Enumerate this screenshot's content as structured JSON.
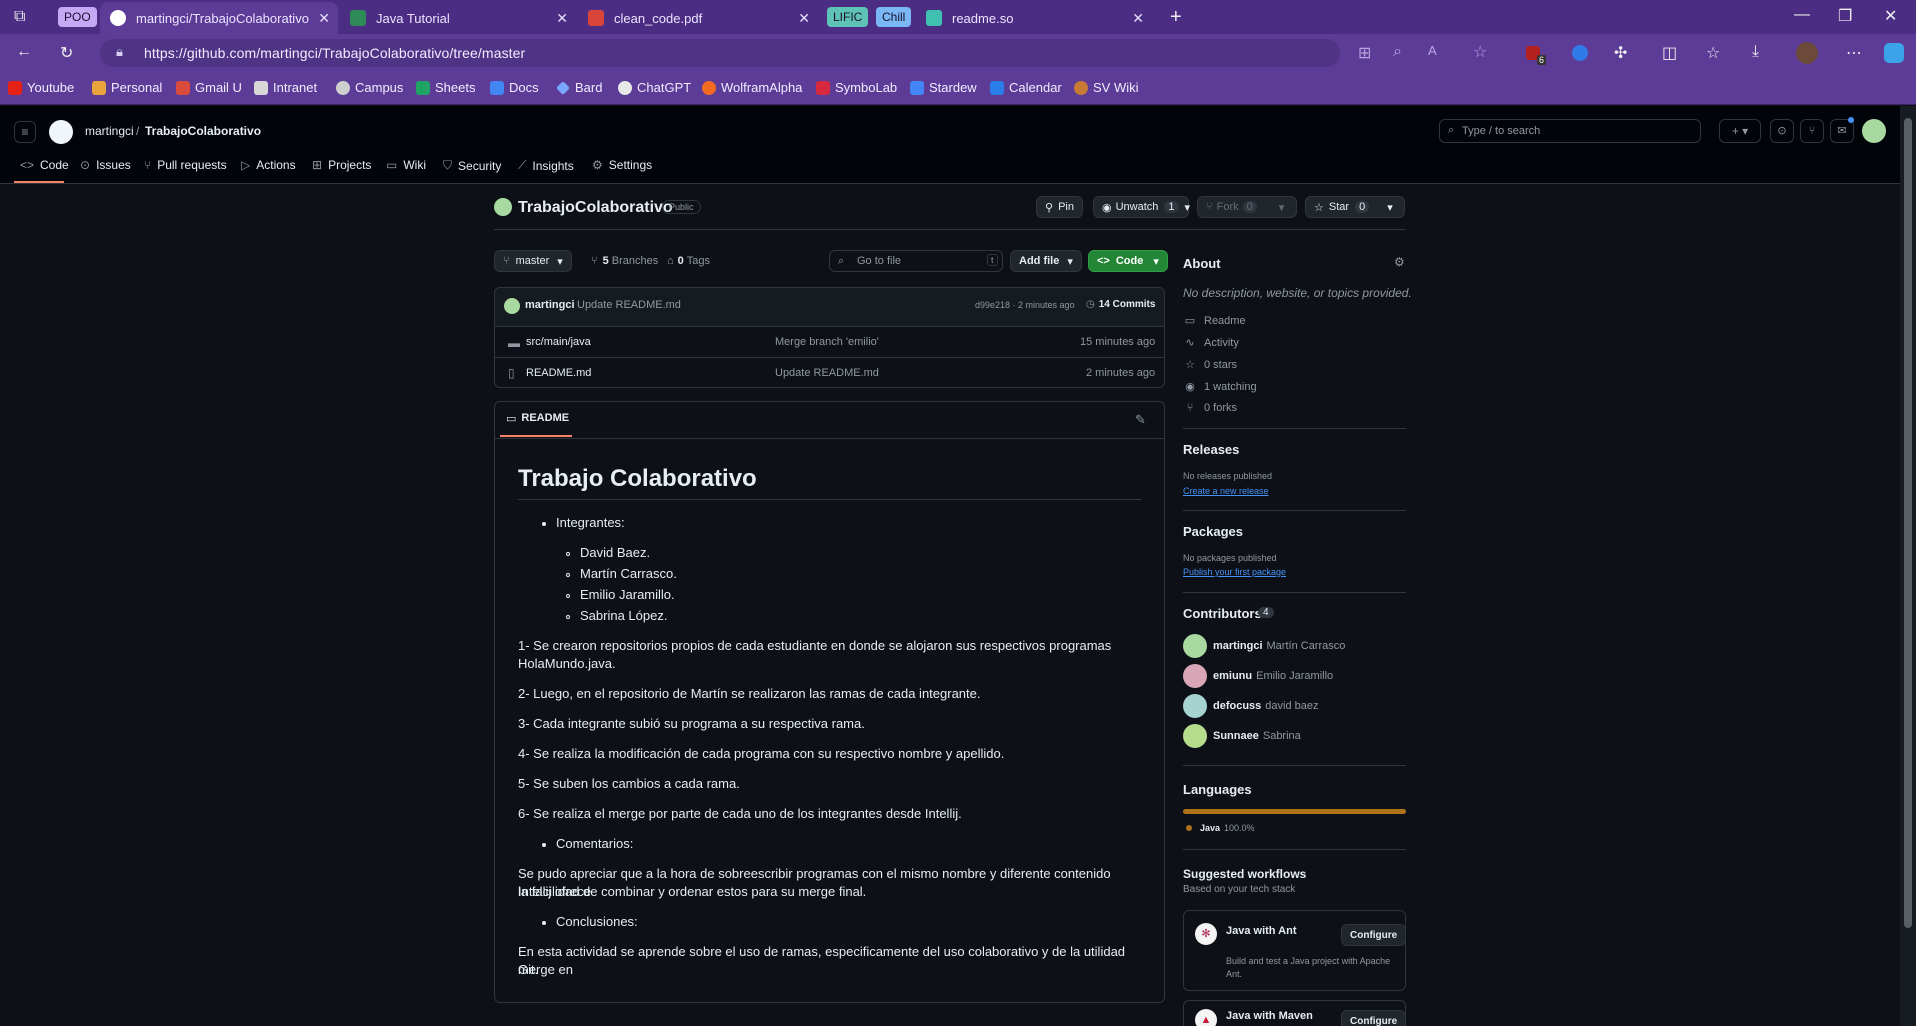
{
  "browser": {
    "tabs": [
      {
        "label": "POO",
        "group": true
      },
      {
        "label": "martingci/TrabajoColaborativo"
      },
      {
        "label": "Java Tutorial"
      },
      {
        "label": "clean_code.pdf"
      },
      {
        "label": "LIFIC",
        "group": true
      },
      {
        "label": "Chill",
        "group": true
      },
      {
        "label": "readme.so"
      }
    ],
    "url": "https://github.com/martingci/TrabajoColaborativo/tree/master",
    "extension_badge": "6",
    "bookmarks": [
      "Youtube",
      "Personal",
      "Gmail U",
      "Intranet",
      "Campus",
      "Sheets",
      "Docs",
      "Bard",
      "ChatGPT",
      "WolframAlpha",
      "SymboLab",
      "Stardew",
      "Calendar",
      "SV Wiki"
    ]
  },
  "github": {
    "owner": "martingci",
    "separator": "/",
    "repo": "TrabajoColaborativo",
    "search_placeholder": "Type / to search",
    "nav": [
      "Code",
      "Issues",
      "Pull requests",
      "Actions",
      "Projects",
      "Wiki",
      "Security",
      "Insights",
      "Settings"
    ],
    "visibility": "Public",
    "buttons": {
      "pin": "Pin",
      "unwatch": "Unwatch",
      "unwatch_count": "1",
      "fork": "Fork",
      "fork_count": "0",
      "star": "Star",
      "star_count": "0"
    },
    "branch": "master",
    "branches_count": "5",
    "branches_label": "Branches",
    "tags_count": "0",
    "tags_label": "Tags",
    "goto_placeholder": "Go to file",
    "goto_key": "t",
    "add_file": "Add file",
    "code_btn": "Code",
    "commit": {
      "author": "martingci",
      "message": "Update README.md",
      "hash": "d99e218 · 2 minutes ago",
      "commits": "14 Commits"
    },
    "files": [
      {
        "name": "src/main/java",
        "message": "Merge branch 'emilio'",
        "time": "15 minutes ago",
        "type": "folder"
      },
      {
        "name": "README.md",
        "message": "Update README.md",
        "time": "2 minutes ago",
        "type": "file"
      }
    ],
    "readme_tab": "README",
    "readme": {
      "title": "Trabajo Colaborativo",
      "integrantes_label": "Integrantes:",
      "members": [
        "David Baez.",
        "Martín Carrasco.",
        "Emilio Jaramillo.",
        "Sabrina López."
      ],
      "p1a": "1- Se crearon repositorios propios de cada estudiante en donde se alojaron sus respectivos programas",
      "p1b": "HolaMundo.java.",
      "p2": "2- Luego, en el repositorio de Martín se realizaron las ramas de cada integrante.",
      "p3": "3- Cada integrante subió su programa a su respectiva rama.",
      "p4": "4- Se realiza la modificación de cada programa con su respectivo nombre y apellido.",
      "p5": "5- Se suben los cambios a cada rama.",
      "p6": "6- Se realiza el merge por parte de cada uno de los integrantes desde Intellij.",
      "comentarios_label": "Comentarios:",
      "c1a": "Se pudo apreciar que a la hora de sobreescribir programas con el mismo nombre y diferente contenido Intellij ofrece",
      "c1b": "la facilidad de combinar y ordenar estos para su merge final.",
      "conclusiones_label": "Conclusiones:",
      "k1a": "En esta actividad se aprende sobre el uso de ramas, especificamente del uso colaborativo y de la utilidad merge en",
      "k1b": "Git."
    },
    "about": {
      "title": "About",
      "description": "No description, website, or topics provided.",
      "items": [
        "Readme",
        "Activity",
        "0 stars",
        "1 watching",
        "0 forks"
      ]
    },
    "releases": {
      "title": "Releases",
      "none": "No releases published",
      "link": "Create a new release"
    },
    "packages": {
      "title": "Packages",
      "none": "No packages published",
      "link": "Publish your first package"
    },
    "contributors": {
      "title": "Contributors",
      "count": "4",
      "list": [
        {
          "login": "martingci",
          "name": "Martín Carrasco"
        },
        {
          "login": "emiunu",
          "name": "Emilio Jaramillo"
        },
        {
          "login": "defocuss",
          "name": "david baez"
        },
        {
          "login": "Sunnaee",
          "name": "Sabrina"
        }
      ]
    },
    "languages": {
      "title": "Languages",
      "name": "Java",
      "percent": "100.0%",
      "share": 1.0,
      "color": "#b07219"
    },
    "workflows": {
      "title": "Suggested workflows",
      "subtitle": "Based on your tech stack",
      "items": [
        {
          "name": "Java with Ant",
          "desc1": "Build and test a Java project with Apache",
          "desc2": "Ant.",
          "action": "Configure"
        },
        {
          "name": "Java with Maven",
          "action": "Configure"
        }
      ]
    }
  }
}
